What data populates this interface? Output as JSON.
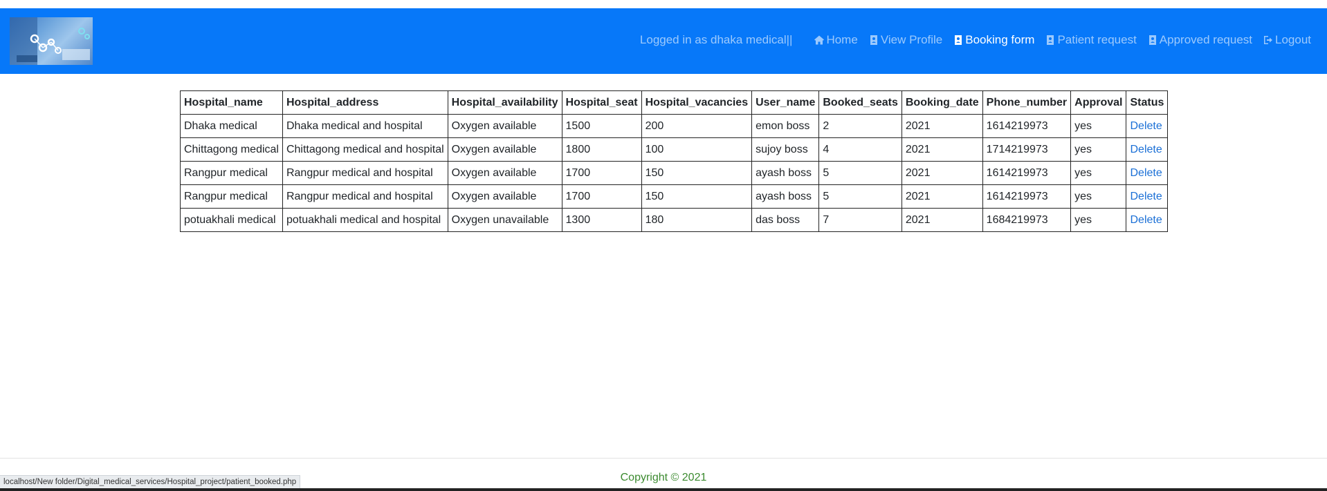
{
  "nav": {
    "logged_in_text": "Logged in as dhaka medical||",
    "items": [
      {
        "label": "Home",
        "icon": "home-icon"
      },
      {
        "label": "View Profile",
        "icon": "profile-icon"
      },
      {
        "label": "Booking form",
        "icon": "booking-icon"
      },
      {
        "label": "Patient request",
        "icon": "patient-icon"
      },
      {
        "label": "Approved request",
        "icon": "approved-icon"
      },
      {
        "label": "Logout",
        "icon": "logout-icon"
      }
    ]
  },
  "table": {
    "headers": [
      "Hospital_name",
      "Hospital_address",
      "Hospital_availability",
      "Hospital_seat",
      "Hospital_vacancies",
      "User_name",
      "Booked_seats",
      "Booking_date",
      "Phone_number",
      "Approval",
      "Status"
    ],
    "rows": [
      [
        "Dhaka medical",
        "Dhaka medical and hospital",
        "Oxygen available",
        "1500",
        "200",
        "emon boss",
        "2",
        "2021",
        "1614219973",
        "yes",
        "Delete"
      ],
      [
        "Chittagong medical",
        "Chittagong medical and hospital",
        "Oxygen available",
        "1800",
        "100",
        "sujoy boss",
        "4",
        "2021",
        "1714219973",
        "yes",
        "Delete"
      ],
      [
        "Rangpur medical",
        "Rangpur medical and hospital",
        "Oxygen available",
        "1700",
        "150",
        "ayash boss",
        "5",
        "2021",
        "1614219973",
        "yes",
        "Delete"
      ],
      [
        "Rangpur medical",
        "Rangpur medical and hospital",
        "Oxygen available",
        "1700",
        "150",
        "ayash boss",
        "5",
        "2021",
        "1614219973",
        "yes",
        "Delete"
      ],
      [
        "potuakhali medical",
        "potuakhali medical and hospital",
        "Oxygen unavailable",
        "1300",
        "180",
        "das boss",
        "7",
        "2021",
        "1684219973",
        "yes",
        "Delete"
      ]
    ]
  },
  "footer": {
    "copyright": "Copyright © 2021"
  },
  "status_bar": {
    "url": "localhost/New folder/Digital_medical_services/Hospital_project/patient_booked.php"
  },
  "colors": {
    "navbar": "#0778f9",
    "link": "#1a6fd6",
    "copyright": "#3b8a2f"
  }
}
